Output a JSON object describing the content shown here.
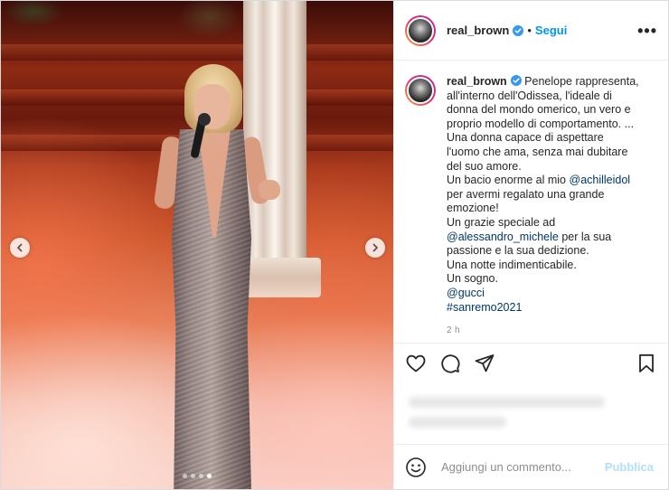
{
  "post": {
    "username": "real_brown",
    "separator": "•",
    "follow_label": "Segui",
    "more_label": "•••",
    "caption_lines": [
      "Penelope rappresenta,",
      "all'interno dell'Odissea, l'ideale di",
      "donna del mondo omerico, un vero e",
      "proprio modello di comportamento. ...",
      "Una donna capace di aspettare",
      "l'uomo che ama, senza mai dubitare",
      "del suo amore.",
      "Un bacio enorme al mio",
      "per avermi regalato una grande",
      "emozione!",
      "Un grazie speciale ad",
      "per la sua",
      "passione e la sua dedizione.",
      "Una notte indimenticabile.",
      "Un sogno.",
      "@gucci",
      "#sanremo2021"
    ],
    "mention_achille": "@achilleidol",
    "mention_alessandro": "@alessandro_michele",
    "time_ago": "2 h",
    "carousel": {
      "total": 4,
      "active_index": 3
    },
    "comment_placeholder": "Aggiungi un commento...",
    "publish_label": "Pubblica",
    "icons": {
      "verified": "verified-badge-icon",
      "like": "heart-icon",
      "comment": "comment-bubble-icon",
      "share": "paper-plane-icon",
      "save": "bookmark-icon",
      "emoji": "smiley-icon",
      "prev": "chevron-left-icon",
      "next": "chevron-right-icon"
    },
    "colors": {
      "accent": "#0095f6",
      "publish_disabled": "#b2dffc",
      "verified": "#3897f0"
    }
  }
}
